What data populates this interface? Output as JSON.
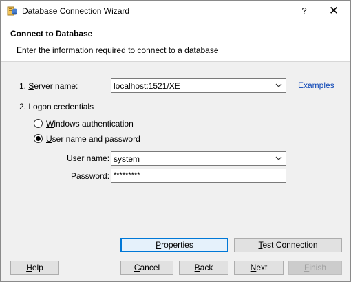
{
  "window": {
    "title": "Database Connection Wizard",
    "help_symbol": "?",
    "close_symbol": "✕"
  },
  "header": {
    "title": "Connect to Database",
    "subtitle": "Enter the information required to connect to a database"
  },
  "server": {
    "label_prefix": "1. ",
    "label_mnemonic": "S",
    "label_rest": "erver name:",
    "value": "localhost:1521/XE",
    "examples_link": "Examples"
  },
  "logon": {
    "label": "2. Logon credentials",
    "windows_auth": {
      "mnemonic": "W",
      "rest": "indows authentication",
      "checked": false
    },
    "user_pass": {
      "mnemonic": "U",
      "rest": "ser name and password",
      "checked": true
    },
    "user_name_label_pre": "User ",
    "user_name_label_mn": "n",
    "user_name_label_post": "ame:",
    "user_name_value": "system",
    "password_label_pre": "Pass",
    "password_label_mn": "w",
    "password_label_post": "ord:",
    "password_value": "*********"
  },
  "buttons": {
    "properties": {
      "mn": "P",
      "rest": "roperties"
    },
    "test_connection": {
      "mn": "T",
      "rest": "est Connection"
    },
    "help": {
      "mn": "H",
      "rest": "elp"
    },
    "cancel": {
      "mn": "C",
      "rest": "ancel"
    },
    "back": {
      "mn": "B",
      "rest": "ack"
    },
    "next": {
      "mn": "N",
      "rest": "ext"
    },
    "finish": {
      "mn": "F",
      "rest": "inish"
    }
  },
  "colors": {
    "link": "#0b45b6",
    "focus": "#0078d7"
  },
  "icons": {
    "app": "database-wizard-icon",
    "combo_arrow": "chevron-down-icon"
  }
}
